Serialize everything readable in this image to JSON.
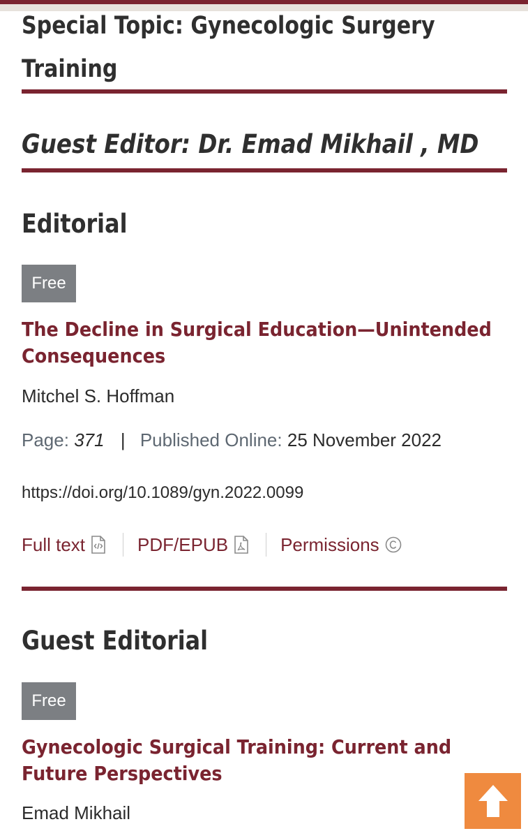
{
  "header": {
    "special_topic_line1": "Special Topic: Gynecologic Surgery",
    "special_topic_line2": "Training",
    "guest_editor": "Guest Editor: Dr. Emad Mikhail , MD"
  },
  "sections": [
    {
      "heading": "Editorial",
      "badge": "Free",
      "article": {
        "title_line1": "The Decline in Surgical Education—Unintended",
        "title_line2": "Consequences",
        "author": "Mitchel S. Hoffman",
        "page_label": "Page:",
        "page_value": "371",
        "separator": "|",
        "published_label": "Published Online:",
        "published_value": "25 November 2022",
        "doi": "https://doi.org/10.1089/gyn.2022.0099",
        "links": {
          "full_text": "Full text",
          "pdf_epub": "PDF/EPUB",
          "permissions": "Permissions"
        }
      }
    },
    {
      "heading": "Guest Editorial",
      "badge": "Free",
      "article": {
        "title_line1": "Gynecologic Surgical Training: Current and",
        "title_line2": "Future Perspectives",
        "author": "Emad Mikhail"
      }
    }
  ],
  "colors": {
    "accent": "#7a2430",
    "badge_bg": "#7c7f83",
    "scroll_top_bg": "#ef8a3f",
    "meta_label": "#5e6872"
  },
  "icons": {
    "full_text": "code-document-icon",
    "pdf_epub": "pdf-document-icon",
    "permissions": "copyright-icon",
    "scroll_top": "arrow-up-icon"
  }
}
